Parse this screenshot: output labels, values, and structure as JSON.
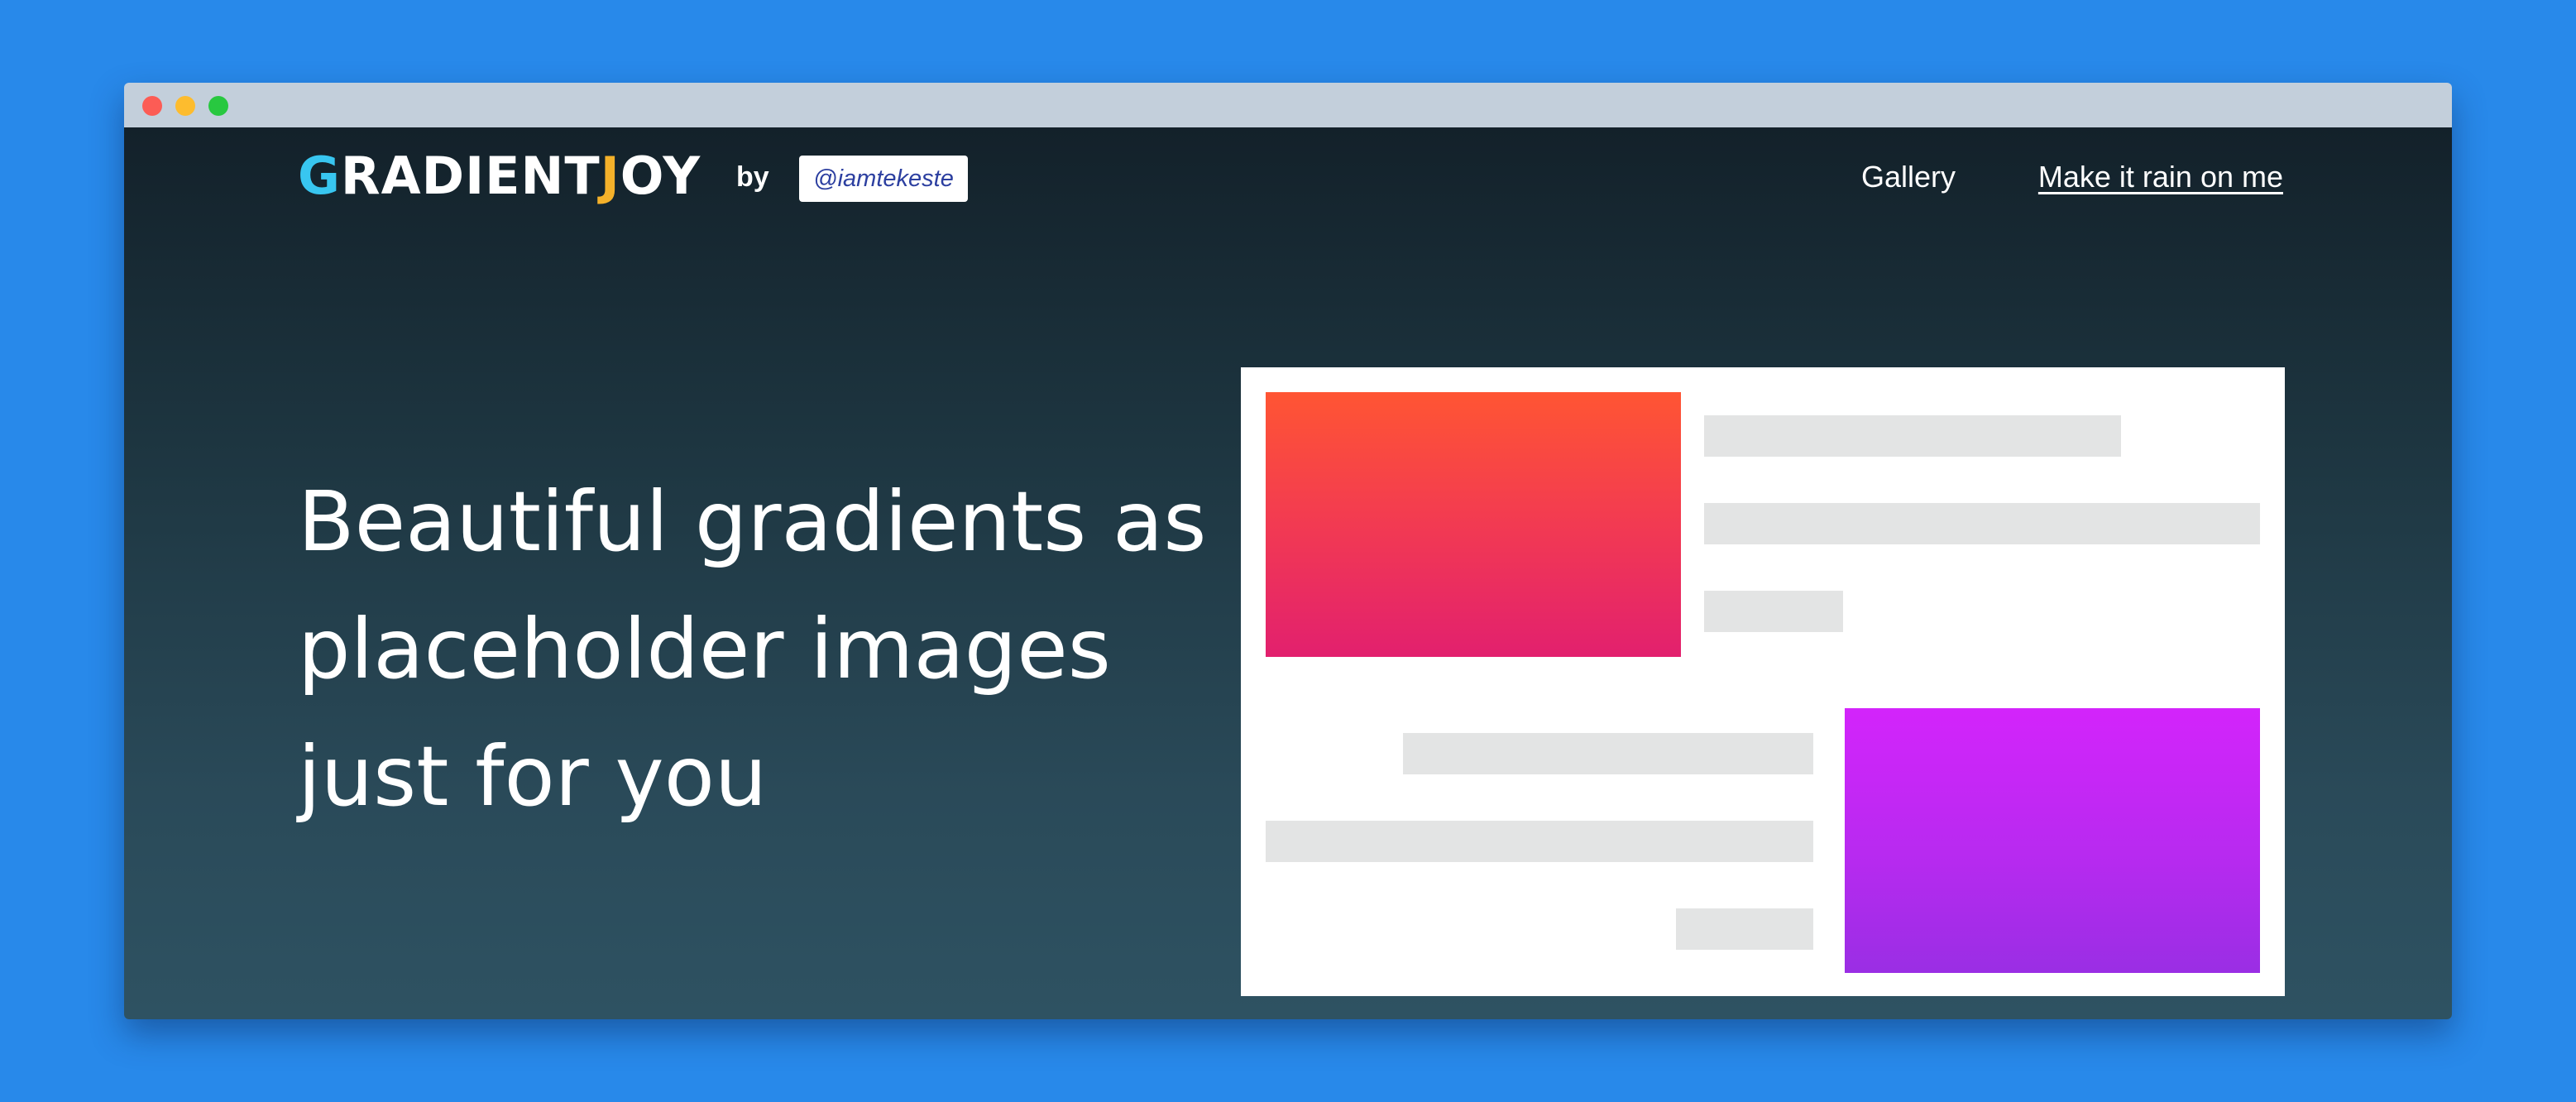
{
  "window": {
    "controls": [
      "close",
      "minimize",
      "maximize"
    ]
  },
  "header": {
    "logo": {
      "first_letter": "G",
      "middle": "RADIENT",
      "accent_letter": "J",
      "last": "OY"
    },
    "by_label": "by",
    "author_handle": "@iamtekeste",
    "nav": {
      "gallery": "Gallery",
      "make_it_rain": "Make it rain on me"
    }
  },
  "hero": {
    "lines": [
      "Beautiful gradients as",
      "placeholder images",
      "just for you"
    ]
  },
  "colors": {
    "background": "#2889ea",
    "logo_accent_blue": "#38c6f0",
    "logo_accent_orange": "#f4b12a",
    "gradient_one": [
      "#ff5533",
      "#e2206e"
    ],
    "gradient_two": [
      "#d324fb",
      "#9a2ee4"
    ],
    "placeholder_bar": "#e3e4e4"
  }
}
